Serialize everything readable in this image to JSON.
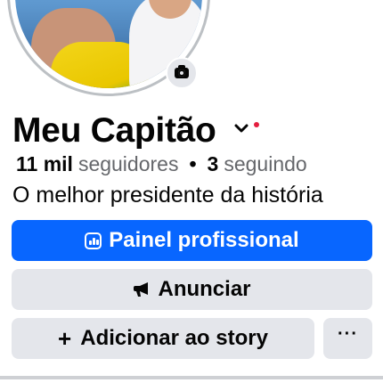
{
  "profile": {
    "name": "Meu Capitão",
    "followers_count": "11 mil",
    "followers_label": "seguidores",
    "separator": "•",
    "following_count": "3",
    "following_label": "seguindo",
    "bio": "O melhor presidente da história"
  },
  "actions": {
    "professional_dashboard_label": "Painel profissional",
    "advertise_label": "Anunciar",
    "add_story_label": "Adicionar ao story",
    "add_story_prefix": "+",
    "more_label": "···"
  },
  "icons": {
    "camera": "camera-icon",
    "chevron": "chevron-down-icon",
    "notification_dot": "notification-dot",
    "dashboard": "dashboard-icon",
    "megaphone": "megaphone-icon",
    "more": "more-icon"
  },
  "colors": {
    "primary": "#0866ff",
    "secondary_bg": "#e4e6eb",
    "text": "#050505",
    "muted_text": "#65676b",
    "notification": "#e41e3f"
  }
}
